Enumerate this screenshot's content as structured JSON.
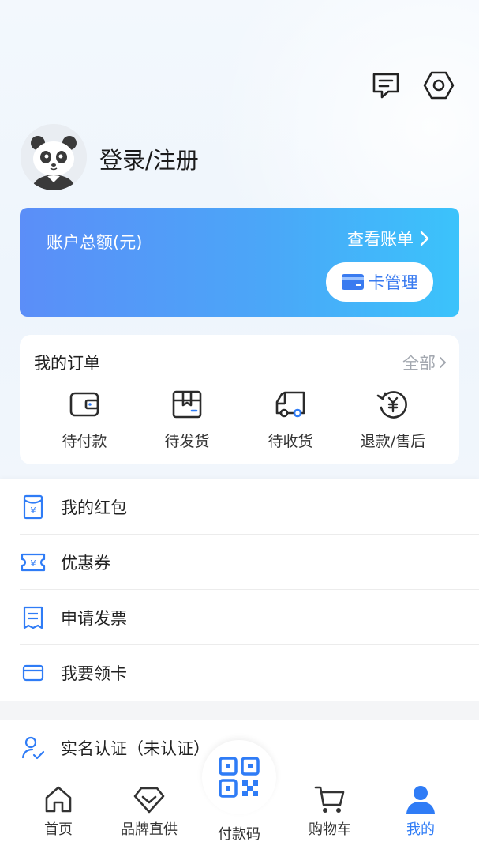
{
  "header": {
    "message_icon": "message-icon",
    "settings_icon": "settings-icon"
  },
  "profile": {
    "login_text": "登录/注册",
    "avatar_icon": "panda-avatar"
  },
  "account": {
    "label": "账户总额(元)",
    "view_bill": "查看账单",
    "card_manage": "卡管理"
  },
  "orders": {
    "title": "我的订单",
    "all": "全部",
    "items": [
      {
        "label": "待付款",
        "icon": "wallet-icon"
      },
      {
        "label": "待发货",
        "icon": "box-icon"
      },
      {
        "label": "待收货",
        "icon": "truck-icon"
      },
      {
        "label": "退款/售后",
        "icon": "refund-icon"
      }
    ]
  },
  "menu": [
    {
      "label": "我的红包",
      "icon": "red-envelope-icon"
    },
    {
      "label": "优惠券",
      "icon": "coupon-icon"
    },
    {
      "label": "申请发票",
      "icon": "invoice-icon"
    },
    {
      "label": "我要领卡",
      "icon": "card-icon"
    }
  ],
  "realname": {
    "label": "实名认证（未认证）",
    "icon": "user-verify-icon"
  },
  "tabbar": {
    "items": [
      {
        "label": "首页",
        "icon": "home-icon"
      },
      {
        "label": "品牌直供",
        "icon": "diamond-icon"
      },
      {
        "label": "付款码",
        "icon": "qrcode-icon"
      },
      {
        "label": "购物车",
        "icon": "cart-icon"
      },
      {
        "label": "我的",
        "icon": "user-icon"
      }
    ],
    "active": "我的"
  },
  "colors": {
    "accent": "#2f7cf6",
    "card_gradient_start": "#5b8ef8",
    "card_gradient_end": "#3bc3fb"
  }
}
